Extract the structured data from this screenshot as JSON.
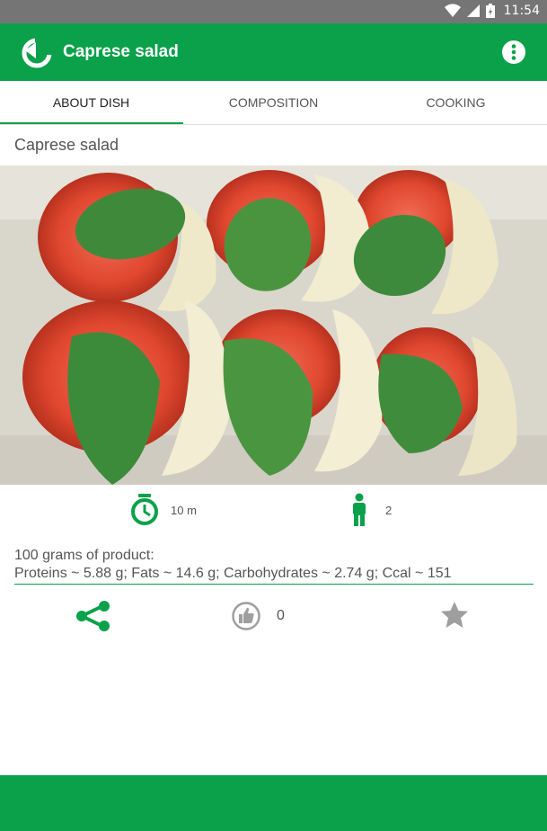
{
  "status_bar": {
    "time": "11:54"
  },
  "app_bar": {
    "title": "Caprese salad"
  },
  "tabs": [
    {
      "label": "ABOUT DISH",
      "active": true
    },
    {
      "label": "COMPOSITION",
      "active": false
    },
    {
      "label": "COOKING",
      "active": false
    }
  ],
  "dish": {
    "name": "Caprese salad",
    "cooking_time": "10 m",
    "servings": "2"
  },
  "nutrition": {
    "heading": "100 grams of product:",
    "values": "Proteins ~ 5.88 g; Fats ~ 14.6 g; Carbohydrates ~ 2.74 g; Ccal ~ 151"
  },
  "actions": {
    "likes": "0"
  },
  "colors": {
    "accent": "#0aa14a",
    "status_bar": "#757575",
    "inactive_icon": "#9e9e9e"
  },
  "icons": [
    "wifi-icon",
    "signal-icon",
    "battery-icon",
    "back-icon",
    "more-vert-icon",
    "timer-icon",
    "person-icon",
    "share-icon",
    "thumb-up-icon",
    "star-icon"
  ]
}
